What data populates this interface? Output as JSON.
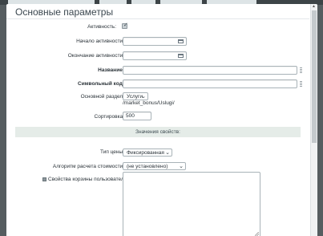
{
  "panel": {
    "title": "Основные параметры"
  },
  "fields": {
    "active_label": "Активность:",
    "active_from_label": "Начало активности:",
    "active_to_label": "Окончание активности:",
    "name_label": "Название:",
    "code_label": "Символьный код:",
    "section_label": "Основной раздел:",
    "section_value": "Услуги",
    "section_path": "/market_bonus/Uslugi/",
    "sort_label": "Сортировка:",
    "sort_value": "500"
  },
  "properties": {
    "header": "Значения свойств:",
    "price_type_label": "Тип цены:",
    "price_type_value": "Фиксированная",
    "algorithm_label": "Алгоритм расчета стоимости:",
    "algorithm_value": "(не установлено)",
    "cart_props_label": "Свойства корзины пользователя:"
  }
}
